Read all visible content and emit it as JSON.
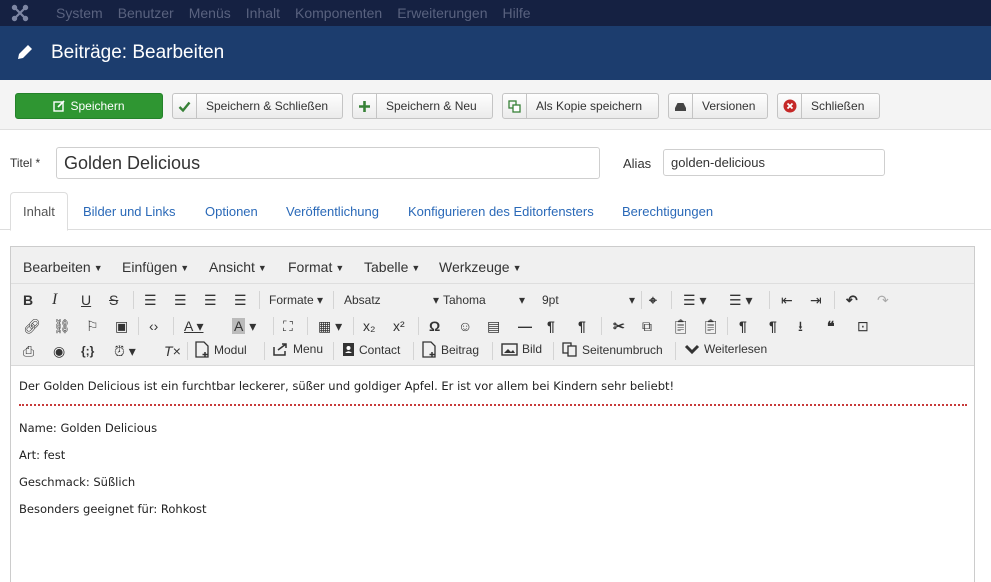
{
  "topmenu": [
    "System",
    "Benutzer",
    "Menüs",
    "Inhalt",
    "Komponenten",
    "Erweiterungen",
    "Hilfe"
  ],
  "page_title": "Beiträge: Bearbeiten",
  "toolbar": {
    "save": "Speichern",
    "save_close": "Speichern & Schließen",
    "save_new": "Speichern & Neu",
    "save_copy": "Als Kopie speichern",
    "versions": "Versionen",
    "close": "Schließen"
  },
  "form": {
    "title_label": "Titel *",
    "title_value": "Golden Delicious",
    "alias_label": "Alias",
    "alias_value": "golden-delicious"
  },
  "tabs": [
    "Inhalt",
    "Bilder und Links",
    "Optionen",
    "Veröffentlichung",
    "Konfigurieren des Editorfensters",
    "Berechtigungen"
  ],
  "editor": {
    "menus": [
      "Bearbeiten",
      "Einfügen",
      "Ansicht",
      "Format",
      "Tabelle",
      "Werkzeuge"
    ],
    "formats_label": "Formate",
    "block_format": "Absatz",
    "font_family": "Tahoma",
    "font_size": "9pt",
    "insert_buttons": {
      "modul": "Modul",
      "menu": "Menu",
      "contact": "Contact",
      "beitrag": "Beitrag",
      "bild": "Bild",
      "pagebreak": "Seitenumbruch",
      "readmore": "Weiterlesen"
    },
    "intro": "Der Golden Delicious ist ein furchtbar leckerer, süßer und goldiger Apfel. Er ist vor allem bei Kindern sehr beliebt!",
    "lines": [
      "Name: Golden Delicious",
      "Art: fest",
      "Geschmack: Süßlich",
      "Besonders geeignet für: Rohkost"
    ]
  },
  "colors": {
    "topbar": "#152142",
    "titlebar": "#1c3d6e",
    "save_green": "#2f9632",
    "link_blue": "#2a69b8",
    "readmore_red": "#c73a3a"
  }
}
